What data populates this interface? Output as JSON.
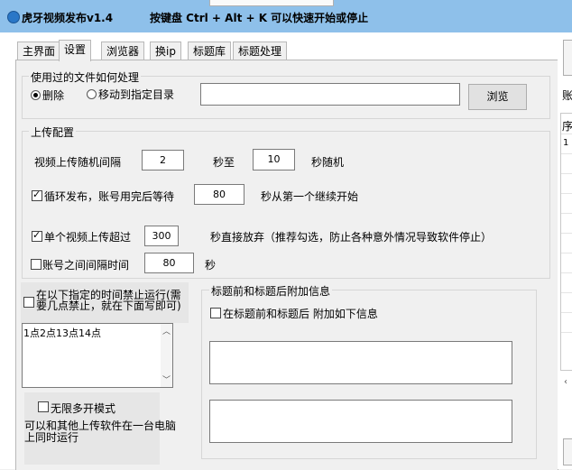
{
  "window": {
    "title": "虎牙视频发布v1.4",
    "hotkey_hint": "按键盘 Ctrl + Alt + K 可以快速开始或停止"
  },
  "tabs": [
    {
      "label": "主界面"
    },
    {
      "label": "设置"
    },
    {
      "label": "浏览器"
    },
    {
      "label": "换ip"
    },
    {
      "label": "标题库"
    },
    {
      "label": "标题处理"
    }
  ],
  "file_group": {
    "title": "使用过的文件如何处理",
    "option_delete": "删除",
    "option_move": "移动到指定目录",
    "selected": "删除",
    "path_value": "",
    "browse_label": "浏览"
  },
  "upload_group": {
    "title": "上传配置",
    "interval_label": "视频上传随机间隔",
    "interval_min": "2",
    "interval_to": "秒至",
    "interval_max": "10",
    "interval_suffix": "秒随机",
    "loop_checked": true,
    "loop_label": "循环发布，账号用完后等待",
    "loop_wait": "80",
    "loop_suffix": "秒从第一个继续开始",
    "timeout_checked": true,
    "timeout_label": "单个视频上传超过",
    "timeout_value": "300",
    "timeout_suffix": "秒直接放弃（推荐勾选，防止各种意外情况导致软件停止）",
    "account_gap_checked": false,
    "account_gap_label": "账号之间间隔时间",
    "account_gap_value": "80",
    "account_gap_suffix": "秒"
  },
  "forbid_time": {
    "checked": false,
    "label": "在以下指定的时间禁止运行(需要几点禁止，就在下面写即可)",
    "hours_text": "1点2点13点14点"
  },
  "multi_open": {
    "checked": false,
    "label": "无限多开模式",
    "description": "可以和其他上传软件在一台电脑上同时运行"
  },
  "title_affix": {
    "title": "标题前和标题后附加信息",
    "checked": false,
    "label": "在标题前和标题后 附加如下信息",
    "prefix_value": "",
    "suffix_value": ""
  },
  "side_panel": {
    "header_char": "账",
    "col_char": "序",
    "row_num": "1"
  }
}
